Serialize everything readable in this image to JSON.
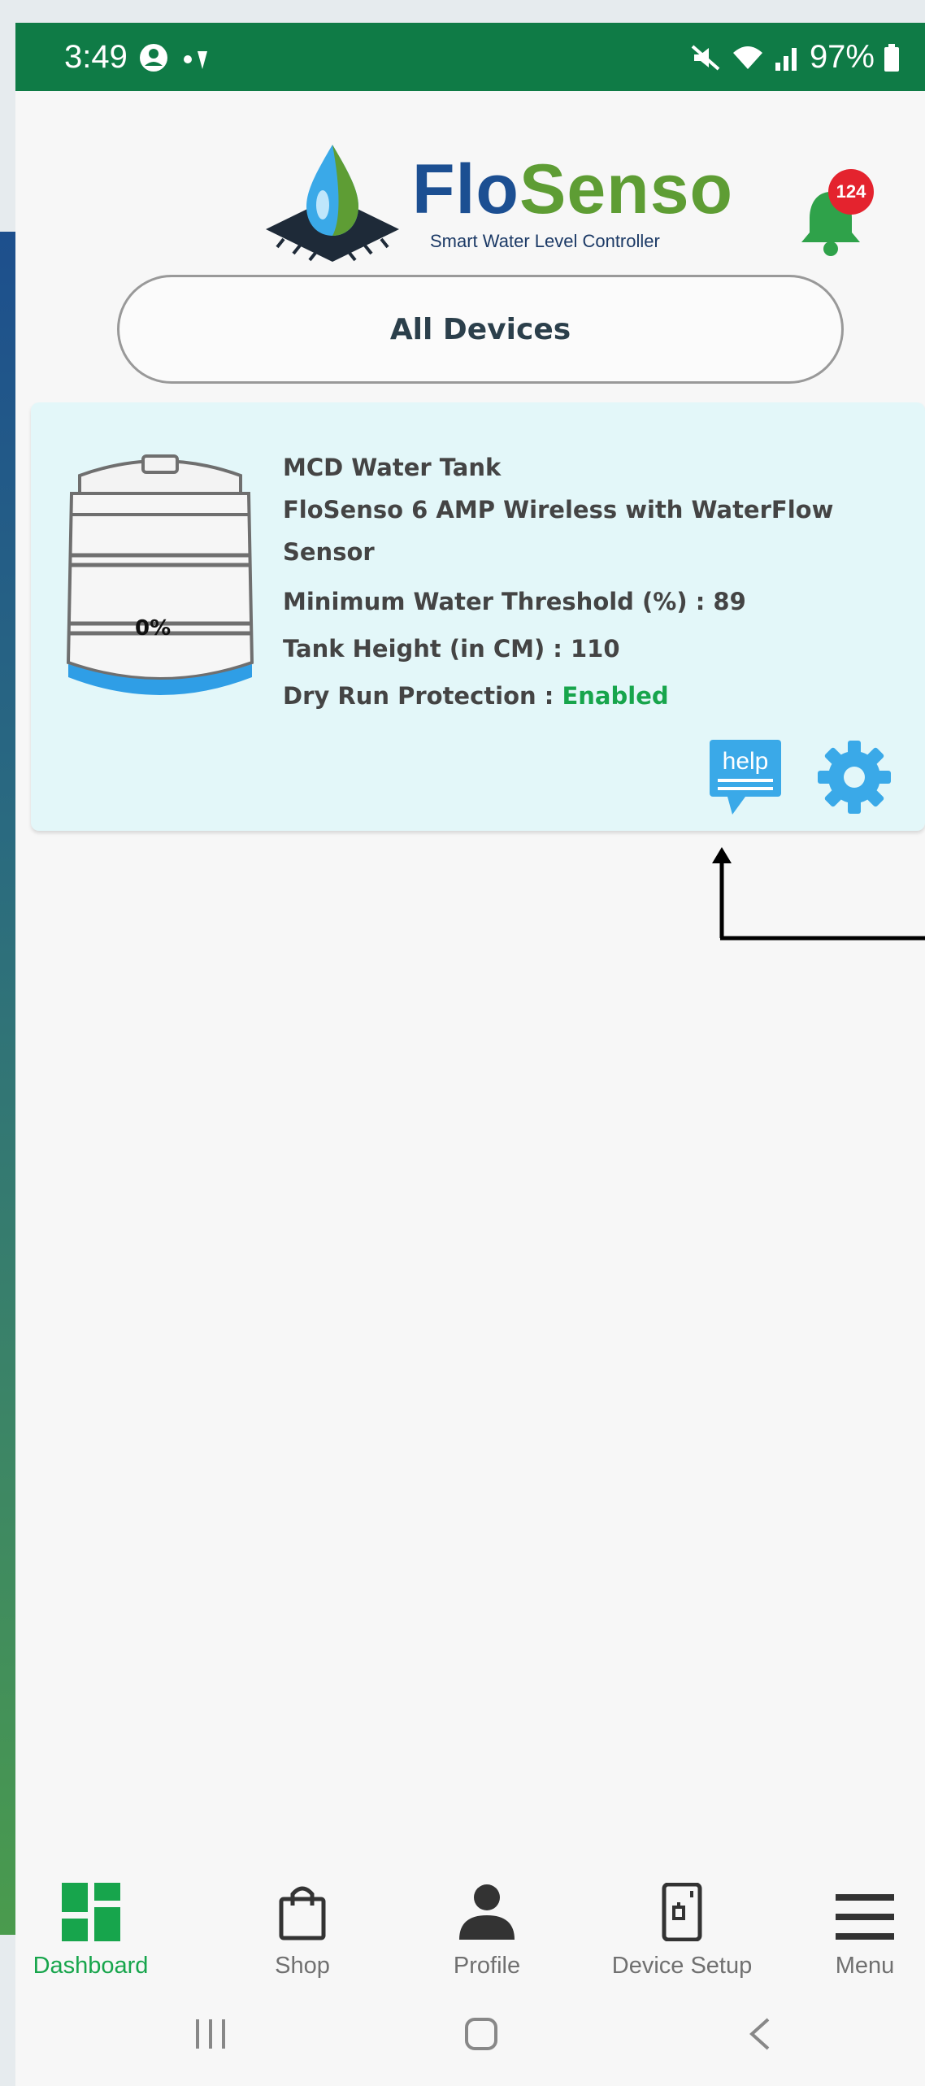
{
  "status_bar": {
    "time": "3:49",
    "battery": "97%"
  },
  "app": {
    "logo_flo": "Flo",
    "logo_senso": "Senso",
    "logo_tagline": "Smart Water Level Controller",
    "notification_count": "124"
  },
  "filter": {
    "label": "All Devices"
  },
  "device": {
    "name": "MCD Water Tank",
    "model": "FloSenso 6 AMP Wireless with WaterFlow Sensor",
    "threshold": "Minimum Water Threshold (%) : 89",
    "tank_height": "Tank Height (in CM) : 110",
    "dry_run_label": "Dry Run Protection : ",
    "dry_run_value": "Enabled",
    "water_level": "0%",
    "help_label": "help"
  },
  "bottom_nav": {
    "items": [
      {
        "label": "Dashboard"
      },
      {
        "label": "Shop"
      },
      {
        "label": "Profile"
      },
      {
        "label": "Device Setup"
      },
      {
        "label": "Menu"
      }
    ]
  },
  "colors": {
    "status_bar": "#0f7b46",
    "accent_green": "#17a54c",
    "brand_blue": "#1c4f92",
    "brand_green": "#5e9d34",
    "card_bg": "#e3f7f9",
    "icon_blue": "#3aa9e8",
    "badge_red": "#e4232e"
  }
}
